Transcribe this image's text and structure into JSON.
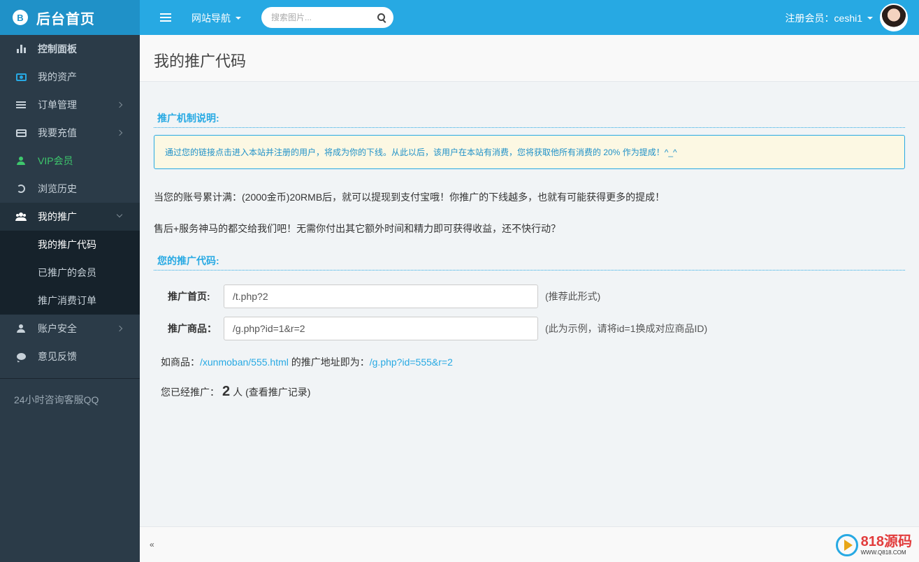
{
  "header": {
    "brand_logo": "B",
    "brand_title": "后台首页",
    "site_nav": "网站导航",
    "search_placeholder": "搜索图片...",
    "user_label": "注册会员：ceshi1"
  },
  "sidebar": {
    "items": [
      {
        "label": "控制面板",
        "icon": "bar-chart-icon"
      },
      {
        "label": "我的资产",
        "icon": "money-icon"
      },
      {
        "label": "订单管理",
        "icon": "list-icon"
      },
      {
        "label": "我要充值",
        "icon": "credit-card-icon"
      },
      {
        "label": "VIP会员",
        "icon": "user-icon"
      },
      {
        "label": "浏览历史",
        "icon": "history-icon"
      },
      {
        "label": "我的推广",
        "icon": "users-icon"
      },
      {
        "label": "账户安全",
        "icon": "user-icon"
      },
      {
        "label": "意见反馈",
        "icon": "comment-icon"
      }
    ],
    "submenu": [
      "我的推广代码",
      "已推广的会员",
      "推广消费订单"
    ],
    "qq_label": "24小时咨询客服QQ"
  },
  "page": {
    "title": "我的推广代码",
    "mechanism_title": "推广机制说明:",
    "notice": "通过您的链接点击进入本站并注册的用户，将成为你的下线。从此以后，该用户在本站有消费，您将获取他所有消费的 20% 作为提成！^_^",
    "para1": "当您的账号累计满：(2000金币)20RMB后，就可以提现到支付宝哦！你推广的下线越多，也就有可能获得更多的提成！",
    "para2": "售后+服务神马的都交给我们吧！无需你付出其它额外时间和精力即可获得收益，还不快行动？",
    "code_title": "您的推广代码:",
    "home_label": "推广首页:",
    "home_value": "/t.php?2",
    "home_hint": "(推荐此形式)",
    "goods_label": "推广商品：",
    "goods_value": "/g.php?id=1&r=2",
    "goods_hint": "(此为示例，请将id=1换成对应商品ID)",
    "example_prefix": "如商品：",
    "example_link": "/xunmoban/555.html",
    "example_mid": " 的推广地址即为：",
    "example_result": "/g.php?id=555&r=2",
    "count_prefix": "您已经推广：",
    "count_value": "2",
    "count_unit": "人",
    "count_link": "(查看推广记录)"
  },
  "footer": {
    "icon": "«",
    "watermark_big": "818源码",
    "watermark_small": "WWW.Q818.COM"
  }
}
